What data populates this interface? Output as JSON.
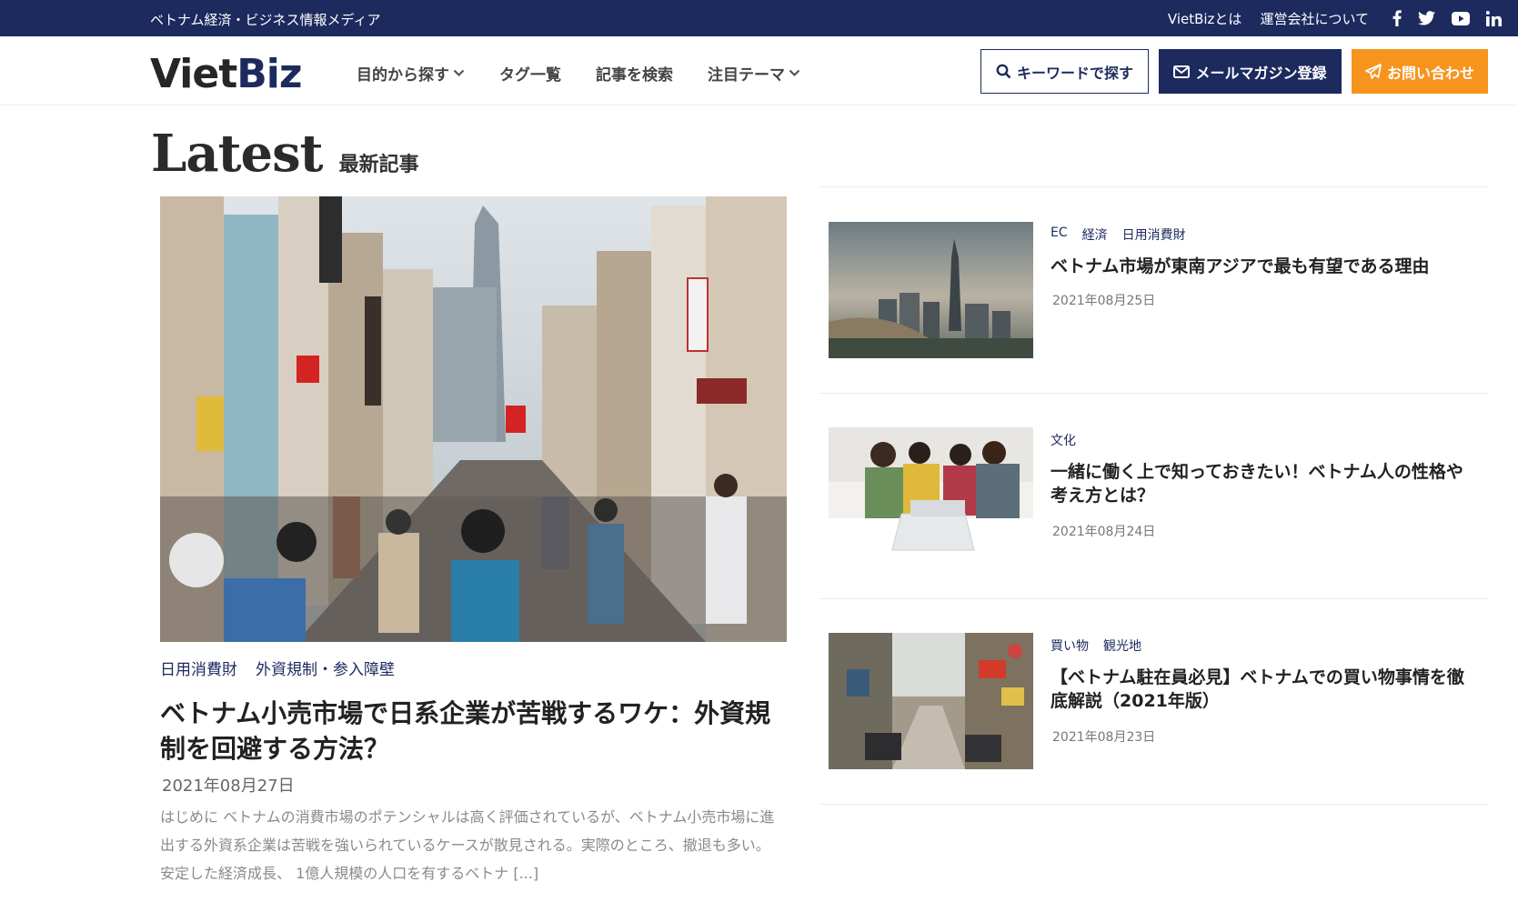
{
  "topbar": {
    "tagline": "ベトナム経済・ビジネス情報メディア",
    "links": [
      "VietBizとは",
      "運営会社について"
    ],
    "social": [
      "facebook-icon",
      "twitter-icon",
      "youtube-icon",
      "linkedin-icon"
    ]
  },
  "header": {
    "logo_viet": "Viet",
    "logo_biz": "Biz",
    "nav": [
      {
        "label": "目的から探す",
        "dropdown": true
      },
      {
        "label": "タグ一覧",
        "dropdown": false
      },
      {
        "label": "記事を検索",
        "dropdown": false
      },
      {
        "label": "注目テーマ",
        "dropdown": true
      }
    ],
    "search_button": "キーワードで探す",
    "mail_button": "メールマガジン登録",
    "contact_button": "お問い合わせ"
  },
  "latest": {
    "heading": "Latest",
    "subheading": "最新記事"
  },
  "featured": {
    "tags": [
      "日用消費財",
      "外資規制・参入障壁"
    ],
    "title": "ベトナム小売市場で日系企業が苦戦するワケ：外資規制を回避する方法？",
    "date": "2021年08月27日",
    "excerpt": "はじめに ベトナムの消費市場のポテンシャルは高く評価されているが、ベトナム小売市場に進出する外資系企業は苦戦を強いられているケースが散見される。実際のところ、撤退も多い。 安定した経済成長、 1億人規模の人口を有するベトナ [...]"
  },
  "side_articles": [
    {
      "tags": [
        "EC",
        "経済",
        "日用消費財"
      ],
      "title": "ベトナム市場が東南アジアで最も有望である理由",
      "date": "2021年08月25日"
    },
    {
      "tags": [
        "文化"
      ],
      "title": "一緒に働く上で知っておきたい！ベトナム人の性格や考え方とは？",
      "date": "2021年08月24日"
    },
    {
      "tags": [
        "買い物",
        "観光地"
      ],
      "title": "【ベトナム駐在員必見】ベトナムでの買い物事情を徹底解説（2021年版）",
      "date": "2021年08月23日"
    }
  ],
  "colors": {
    "navy": "#1c2a5e",
    "orange": "#f7941d"
  }
}
